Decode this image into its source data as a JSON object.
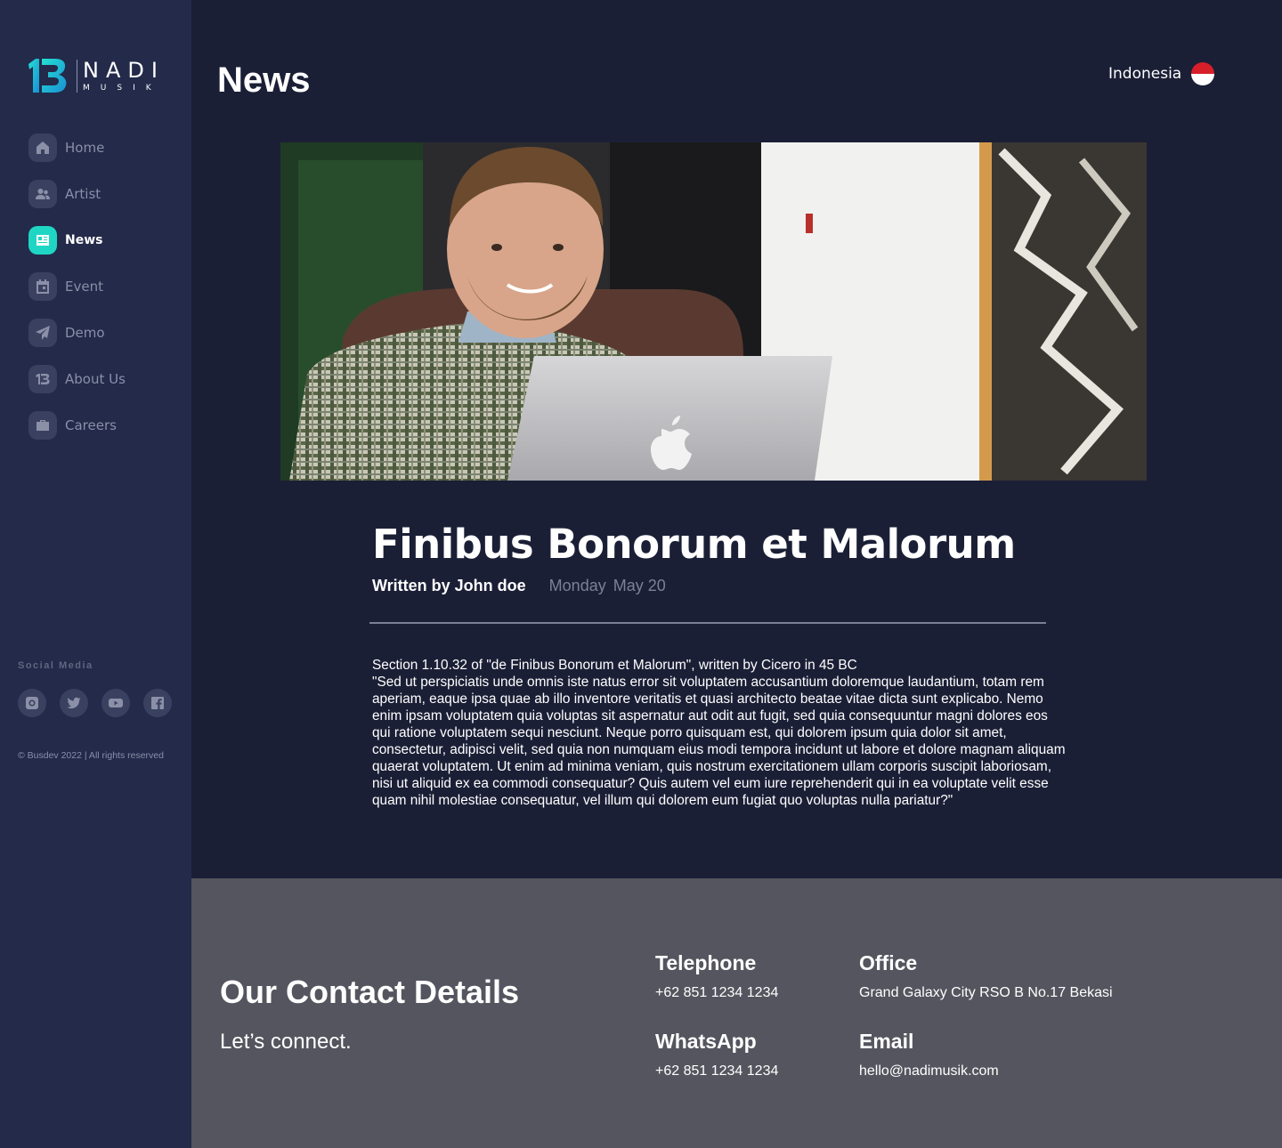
{
  "brand": {
    "name": "NADI",
    "sub": "MUSIK",
    "accent_color": "#1fd6c4"
  },
  "sidebar": {
    "items": [
      {
        "label": "Home",
        "icon": "home-icon"
      },
      {
        "label": "Artist",
        "icon": "users-icon"
      },
      {
        "label": "News",
        "icon": "newspaper-icon",
        "active": true
      },
      {
        "label": "Event",
        "icon": "calendar-icon"
      },
      {
        "label": "Demo",
        "icon": "send-icon"
      },
      {
        "label": "About Us",
        "icon": "logo-icon"
      },
      {
        "label": "Careers",
        "icon": "briefcase-icon"
      }
    ],
    "social_title": "Social Media",
    "social": [
      "instagram-icon",
      "twitter-icon",
      "youtube-icon",
      "facebook-icon"
    ],
    "copyright": "© Busdev 2022 | All rights reserved"
  },
  "header": {
    "title": "News",
    "language": "Indonesia"
  },
  "article": {
    "title": "Finibus Bonorum et Malorum",
    "author": "Written by John doe",
    "day": "Monday",
    "date": "May 20",
    "body_line1": "Section 1.10.32 of \"de Finibus Bonorum et Malorum\", written by Cicero in 45 BC",
    "body_line2": "\"Sed ut perspiciatis unde omnis iste natus error sit voluptatem accusantium doloremque laudantium, totam rem aperiam, eaque ipsa quae ab illo inventore veritatis et quasi architecto beatae vitae dicta sunt explicabo. Nemo enim ipsam voluptatem quia voluptas sit aspernatur aut odit aut fugit, sed quia consequuntur magni dolores eos qui ratione voluptatem sequi nesciunt. Neque porro quisquam est, qui dolorem ipsum quia dolor sit amet, consectetur, adipisci velit, sed quia non numquam eius modi tempora incidunt ut labore et dolore magnam aliquam quaerat voluptatem. Ut enim ad minima veniam, quis nostrum exercitationem ullam corporis suscipit laboriosam, nisi ut aliquid ex ea commodi consequatur? Quis autem vel eum iure reprehenderit qui in ea voluptate velit esse quam nihil molestiae consequatur, vel illum qui dolorem eum fugiat quo voluptas nulla pariatur?\""
  },
  "footer": {
    "title": "Our Contact Details",
    "subtitle": "Let’s connect.",
    "telephone_label": "Telephone",
    "telephone": "+62 851 1234 1234",
    "whatsapp_label": "WhatsApp",
    "whatsapp": "+62 851 1234 1234",
    "office_label": "Office",
    "office": "Grand Galaxy City RSO B No.17 Bekasi",
    "email_label": "Email",
    "email": "hello@nadimusik.com"
  }
}
